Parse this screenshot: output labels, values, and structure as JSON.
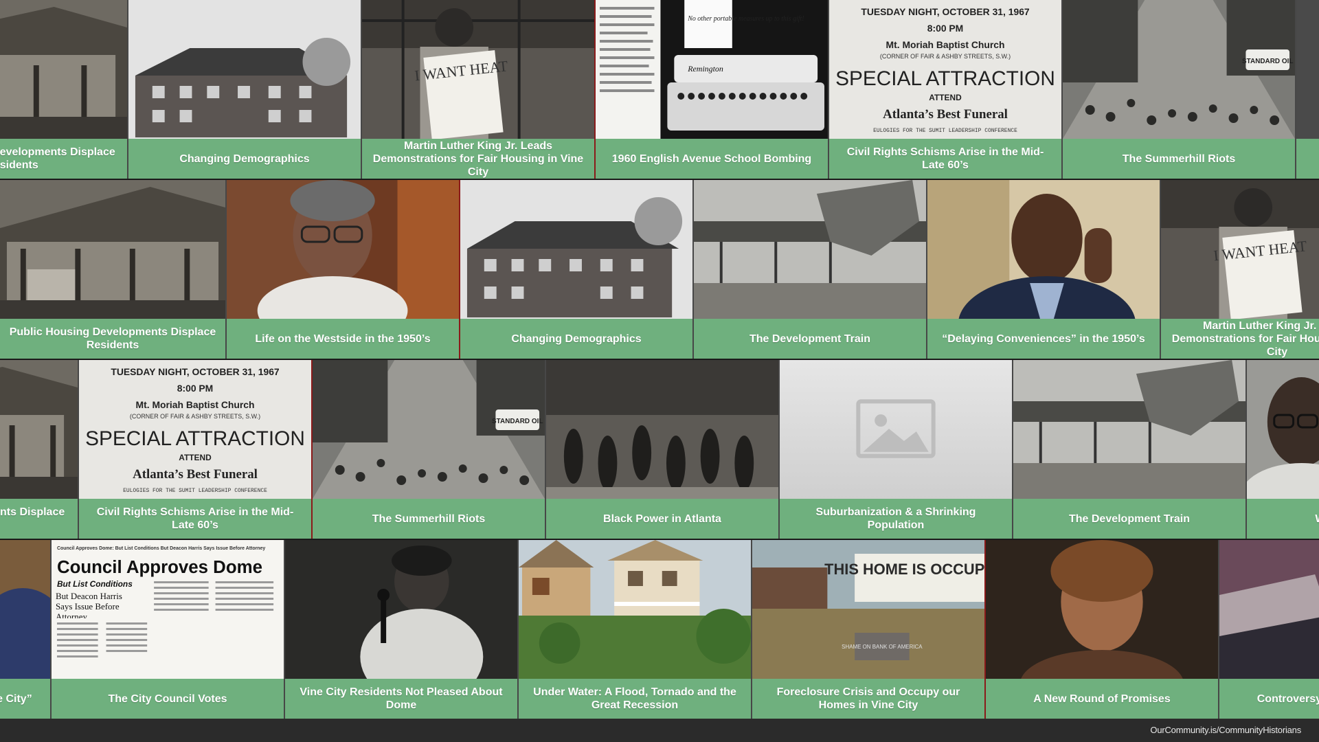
{
  "rows": [
    {
      "tiles": [
        {
          "caption": "Public Housing Developments Displace Residents",
          "kind": "porch"
        },
        {
          "caption": "Changing Demographics",
          "kind": "apartment"
        },
        {
          "caption": "Martin Luther King Jr. Leads Demonstrations for Fair Housing in Vine City",
          "kind": "boy-sign",
          "selected": true
        },
        {
          "caption": "1960 English Avenue School Bombing",
          "kind": "typewriter"
        },
        {
          "caption": "Civil Rights Schisms Arise in the Mid-Late 60’s",
          "kind": "flyer"
        },
        {
          "caption": "The Summerhill Riots",
          "kind": "street-crowd"
        },
        {
          "caption": "",
          "kind": "dark"
        }
      ]
    },
    {
      "tiles": [
        {
          "caption": "Public Housing Developments Displace Residents",
          "kind": "porch"
        },
        {
          "caption": "Life on the Westside in the 1950’s",
          "kind": "woman-portrait",
          "selected": true
        },
        {
          "caption": "Changing Demographics",
          "kind": "apartment"
        },
        {
          "caption": "The Development Train",
          "kind": "excavator"
        },
        {
          "caption": "“Delaying Conveniences” in the 1950’s",
          "kind": "man-portrait"
        },
        {
          "caption": "Martin Luther King Jr. Leads Demonstrations for Fair Housing in Vine City",
          "kind": "boy-sign"
        }
      ]
    },
    {
      "tiles": [
        {
          "caption": "Public Housing Developments Displace Residents",
          "kind": "porch"
        },
        {
          "caption": "Civil Rights Schisms Arise in the Mid-Late 60’s",
          "kind": "flyer",
          "selected": true
        },
        {
          "caption": "The Summerhill Riots",
          "kind": "street-crowd"
        },
        {
          "caption": "Black Power in Atlanta",
          "kind": "riot"
        },
        {
          "caption": "Suburbanization & a Shrinking Population",
          "kind": "placeholder"
        },
        {
          "caption": "The Development Train",
          "kind": "excavator"
        },
        {
          "caption": "Westside Success",
          "kind": "woman-glasses"
        }
      ]
    },
    {
      "tiles": [
        {
          "caption": "“Delaying Conveniences” in the City”",
          "kind": "man-portrait"
        },
        {
          "caption": "The City Council Votes",
          "kind": "newspaper"
        },
        {
          "caption": "Vine City Residents Not Pleased About Dome",
          "kind": "speaker"
        },
        {
          "caption": "Under Water: A Flood, Tornado and the Great Recession",
          "kind": "houses"
        },
        {
          "caption": "Foreclosure Crisis and Occupy our Homes in Vine City",
          "kind": "occupy",
          "selected": true
        },
        {
          "caption": "A New Round of Promises",
          "kind": "woman-modern"
        },
        {
          "caption": "Controversy over the Stadium",
          "kind": "stadium"
        }
      ]
    }
  ],
  "text_in_images": {
    "sign_boy": "I WANT HEAT",
    "typewriter_ad": "No other portable measures up to this gift!",
    "typewriter_brand": "Remington",
    "flyer": {
      "line1": "TUESDAY NIGHT, OCTOBER 31, 1967",
      "line2": "8:00 PM",
      "line3": "Mt. Moriah Baptist Church",
      "line4": "(CORNER OF FAIR & ASHBY STREETS, S.W.)",
      "line5": "SPECIAL ATTRACTION",
      "line6": "ATTEND",
      "line7": "Atlanta’s Best Funeral",
      "line8": "EULOGIES FOR THE SUMIT LEADERSHIP CONFERENCE"
    },
    "gas_sign": "STANDARD OIL",
    "newspaper": {
      "kicker": "Council Approves Dome: But List Conditions But Deacon Harris Says Issue Before Attorney",
      "headline": "Council Approves Dome",
      "sub1": "But List Conditions",
      "sub2": "But Deacon Harris Says Issue Before Attorney"
    },
    "occupy_sign": "THIS HOME IS OCCUPIED!",
    "occupy_sign2": "SHAME ON BANK OF AMERICA"
  },
  "footer": {
    "credit": "OurCommunity.is/CommunityHistorians"
  }
}
